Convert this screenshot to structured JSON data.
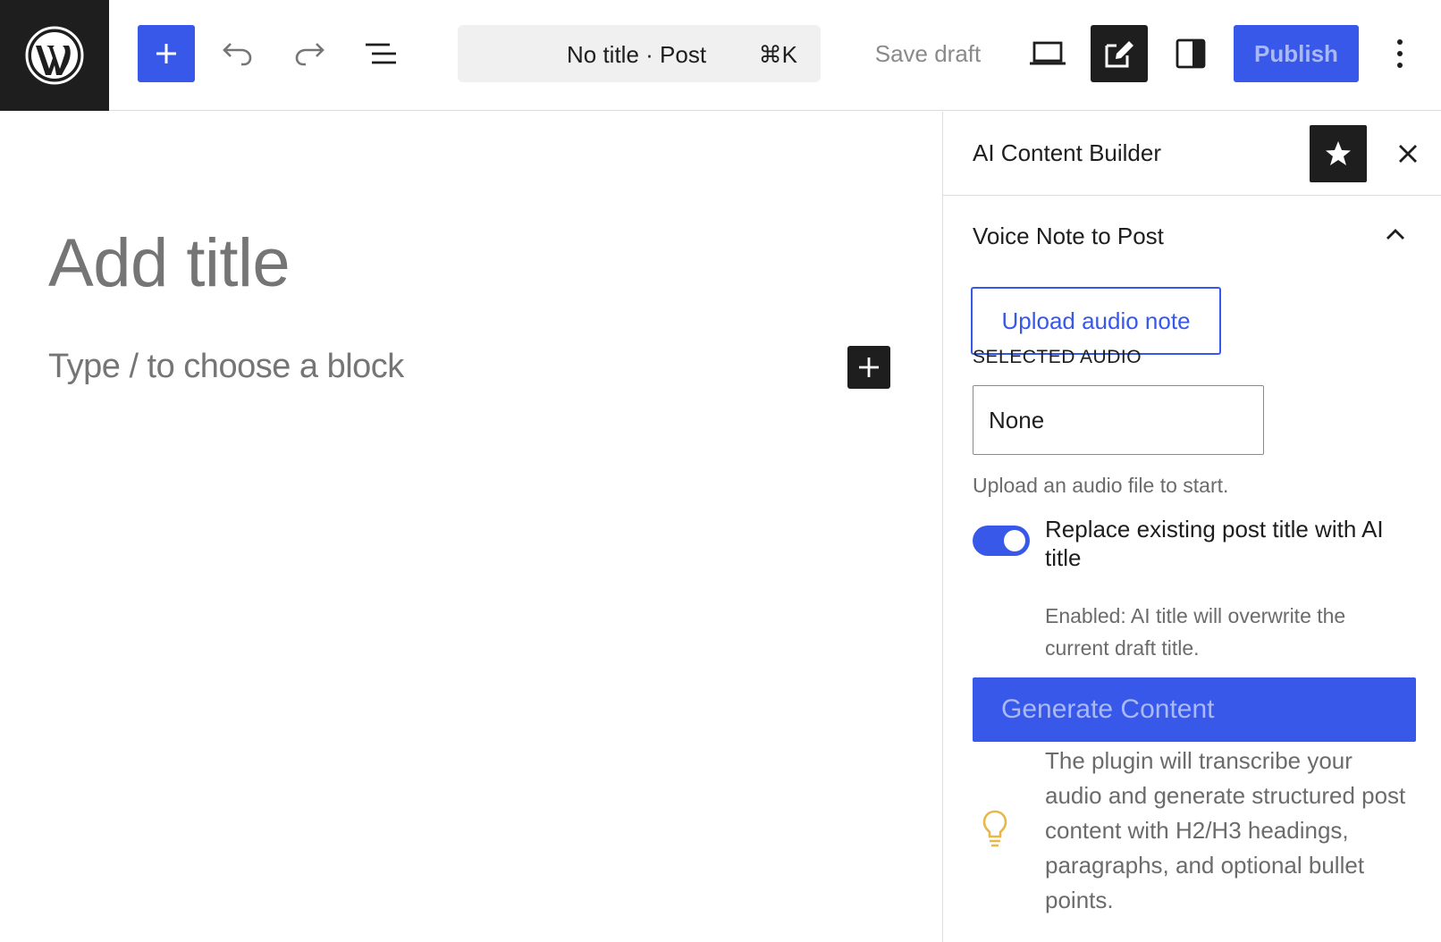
{
  "toolbar": {
    "inserter_icon": "plus-icon",
    "undo_icon": "undo-icon",
    "redo_icon": "redo-icon",
    "listview_icon": "list-view-icon",
    "command": {
      "title": "No title · Post",
      "shortcut": "⌘K"
    },
    "save_draft_label": "Save draft",
    "preview_icon": "laptop-icon",
    "edit_icon": "edit-icon",
    "settings_icon": "sidebar-toggle-icon",
    "publish_label": "Publish",
    "more_icon": "kebab-menu-icon"
  },
  "editor": {
    "title_placeholder": "Add title",
    "block_placeholder": "Type / to choose a block"
  },
  "sidebar": {
    "title": "AI Content Builder",
    "panel": {
      "title": "Voice Note to Post",
      "expanded": true,
      "upload_label": "Upload audio note",
      "selected_audio_label": "SELECTED AUDIO",
      "selected_audio_value": "None",
      "help_text": "Upload an audio file to start.",
      "toggle": {
        "checked": true,
        "label": "Replace existing post title with AI title",
        "help": "Enabled: AI title will overwrite the current draft title."
      },
      "generate_label": "Generate Content",
      "tip": "The plugin will transcribe your audio and generate structured post content with H2/H3 headings, paragraphs, and optional bullet points."
    }
  },
  "colors": {
    "accent": "#3858e9",
    "dark": "#1e1e1e",
    "muted_text": "#757575",
    "tip_icon": "#e7b748"
  }
}
